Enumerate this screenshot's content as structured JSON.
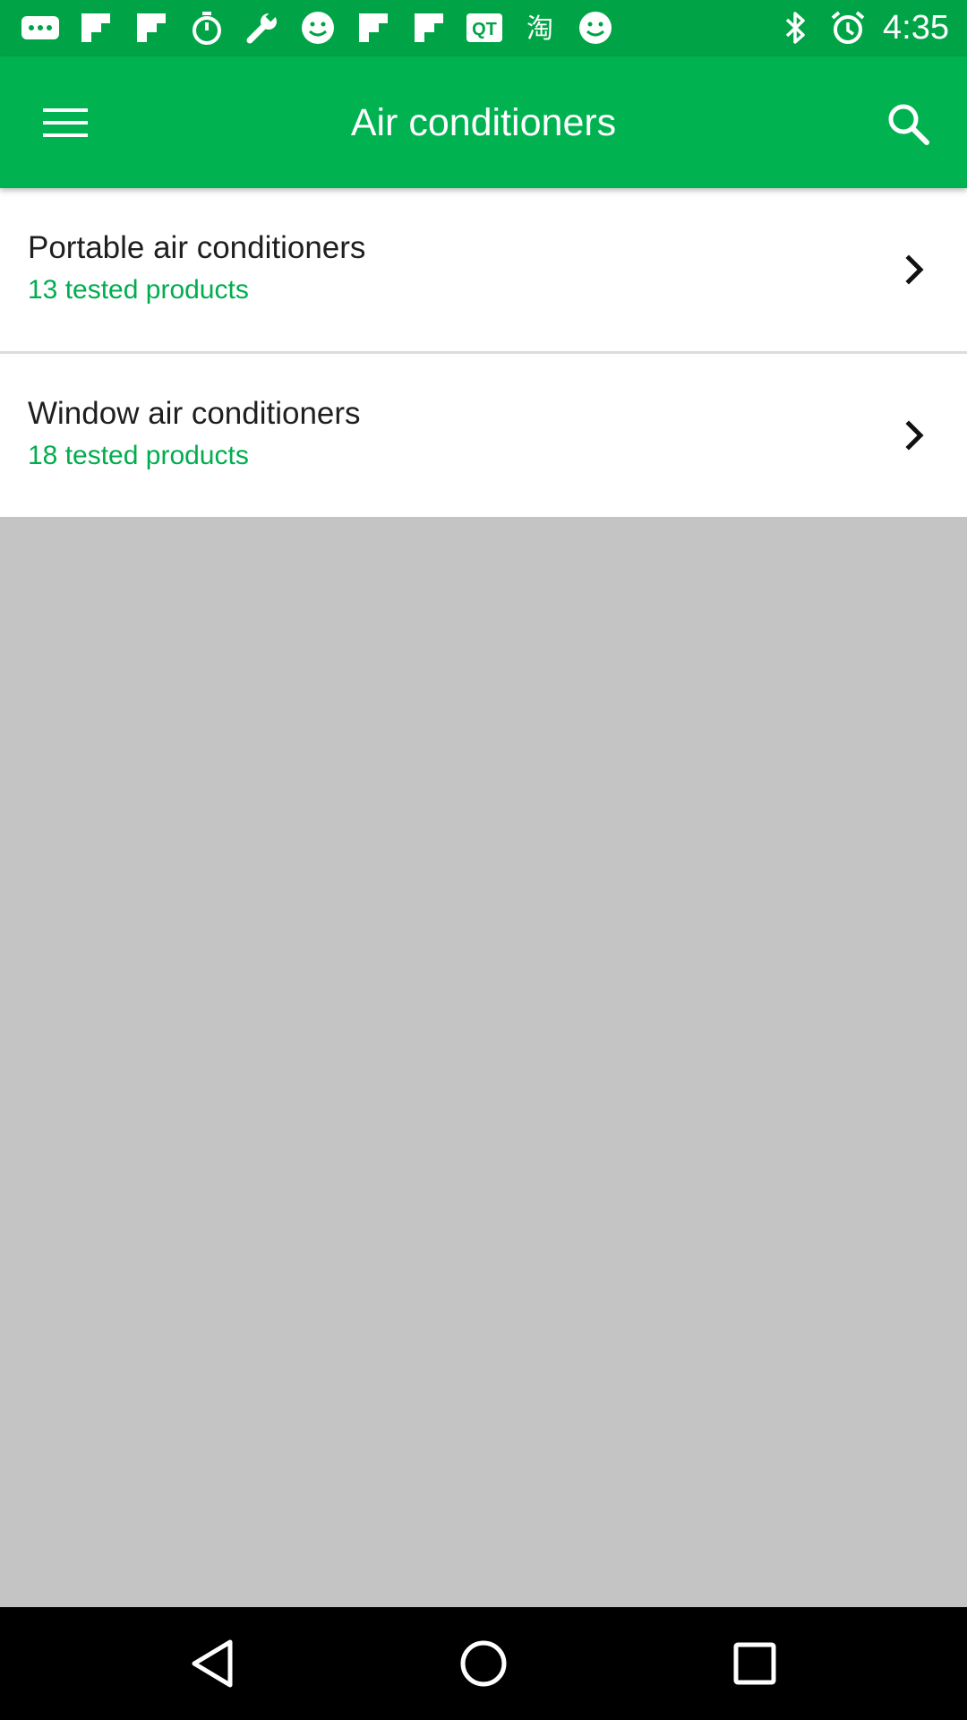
{
  "status_bar": {
    "time": "4:35",
    "icons": [
      "more-icon",
      "flipboard-icon",
      "flipboard-icon",
      "stopwatch-icon",
      "wrench-icon",
      "smiley-icon",
      "flipboard-icon",
      "flipboard-icon",
      "qq-icon",
      "taobao-icon",
      "smiley-icon",
      "bluetooth-icon",
      "alarm-icon"
    ]
  },
  "app_bar": {
    "title": "Air conditioners",
    "menu_icon": "hamburger-menu-icon",
    "search_icon": "search-icon"
  },
  "list": {
    "items": [
      {
        "title": "Portable air conditioners",
        "subtitle": "13 tested products"
      },
      {
        "title": "Window air conditioners",
        "subtitle": "18 tested products"
      }
    ]
  },
  "nav_bar": {
    "buttons": [
      "back-icon",
      "home-icon",
      "recents-icon"
    ]
  },
  "colors": {
    "status_bar": "#00a446",
    "app_bar": "#00b250",
    "subtitle_green": "#00ad4f",
    "background": "#c4c4c4"
  }
}
